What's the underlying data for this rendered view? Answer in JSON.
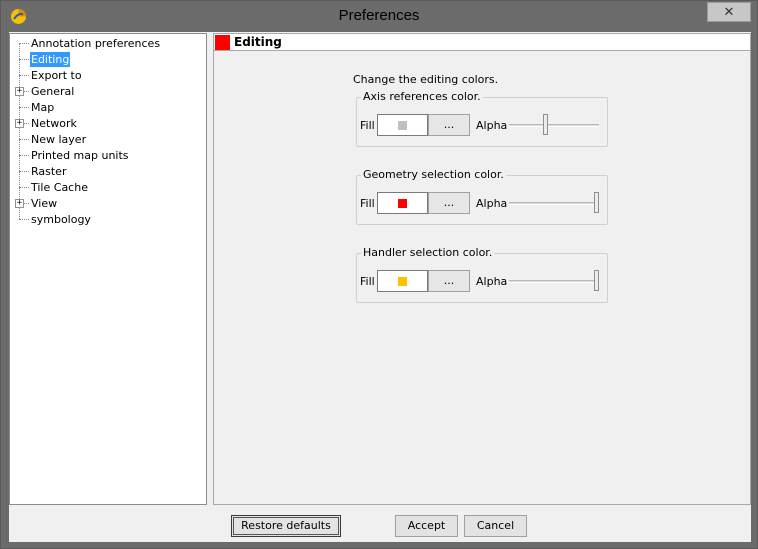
{
  "window": {
    "title": "Preferences",
    "close_glyph": "✕",
    "app_icon": "gvsig-app-icon"
  },
  "tree": {
    "items": [
      {
        "label": "Annotation preferences",
        "expandable": false,
        "selected": false
      },
      {
        "label": "Editing",
        "expandable": false,
        "selected": true
      },
      {
        "label": "Export to",
        "expandable": false,
        "selected": false
      },
      {
        "label": "General",
        "expandable": true,
        "selected": false
      },
      {
        "label": "Map",
        "expandable": false,
        "selected": false
      },
      {
        "label": "Network",
        "expandable": true,
        "selected": false
      },
      {
        "label": "New layer",
        "expandable": false,
        "selected": false
      },
      {
        "label": "Printed map units",
        "expandable": false,
        "selected": false
      },
      {
        "label": "Raster",
        "expandable": false,
        "selected": false
      },
      {
        "label": "Tile Cache",
        "expandable": false,
        "selected": false
      },
      {
        "label": "View",
        "expandable": true,
        "selected": false
      },
      {
        "label": "symbology",
        "expandable": false,
        "selected": false
      }
    ],
    "expander_glyph": "+"
  },
  "panel": {
    "title": "Editing",
    "title_color": "#ff0000",
    "instructions": "Change the editing colors.",
    "groups": [
      {
        "title": "Axis references color.",
        "fill_label": "Fill",
        "button_label": "...",
        "alpha_label": "Alpha",
        "color": "#c0c0c0",
        "alpha_percent": 40
      },
      {
        "title": "Geometry selection color.",
        "fill_label": "Fill",
        "button_label": "...",
        "alpha_label": "Alpha",
        "color": "#ff0000",
        "alpha_percent": 100
      },
      {
        "title": "Handler selection color.",
        "fill_label": "Fill",
        "button_label": "...",
        "alpha_label": "Alpha",
        "color": "#ffc000",
        "alpha_percent": 100
      }
    ]
  },
  "buttons": {
    "restore": "Restore defaults",
    "accept": "Accept",
    "cancel": "Cancel"
  }
}
